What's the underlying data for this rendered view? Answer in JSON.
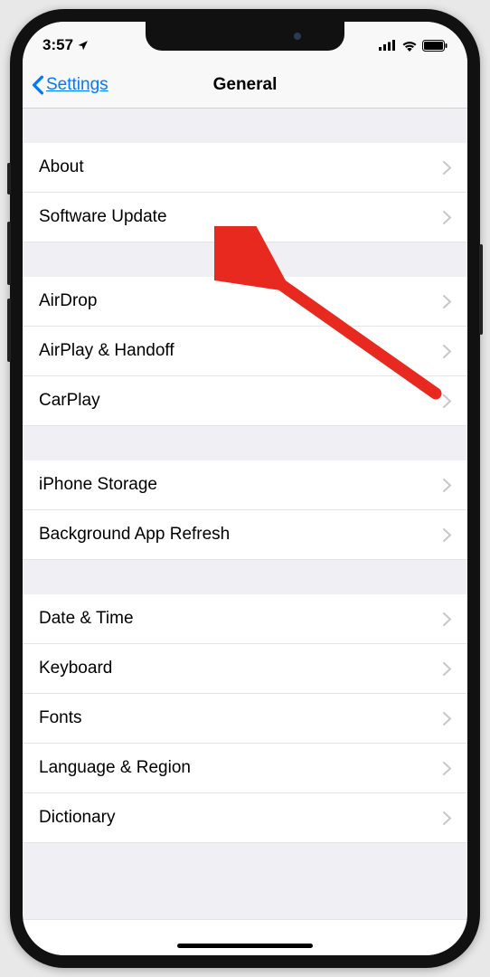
{
  "status": {
    "time": "3:57",
    "location_on": true
  },
  "nav": {
    "back_label": "Settings",
    "title": "General"
  },
  "groups": [
    {
      "rows": [
        {
          "id": "about",
          "label": "About"
        },
        {
          "id": "software-update",
          "label": "Software Update"
        }
      ]
    },
    {
      "rows": [
        {
          "id": "airdrop",
          "label": "AirDrop"
        },
        {
          "id": "airplay-handoff",
          "label": "AirPlay & Handoff"
        },
        {
          "id": "carplay",
          "label": "CarPlay"
        }
      ]
    },
    {
      "rows": [
        {
          "id": "iphone-storage",
          "label": "iPhone Storage"
        },
        {
          "id": "background-app-refresh",
          "label": "Background App Refresh"
        }
      ]
    },
    {
      "rows": [
        {
          "id": "date-time",
          "label": "Date & Time"
        },
        {
          "id": "keyboard",
          "label": "Keyboard"
        },
        {
          "id": "fonts",
          "label": "Fonts"
        },
        {
          "id": "language-region",
          "label": "Language & Region"
        },
        {
          "id": "dictionary",
          "label": "Dictionary"
        }
      ]
    }
  ],
  "annotation": {
    "color": "#e8291f",
    "target": "software-update"
  }
}
